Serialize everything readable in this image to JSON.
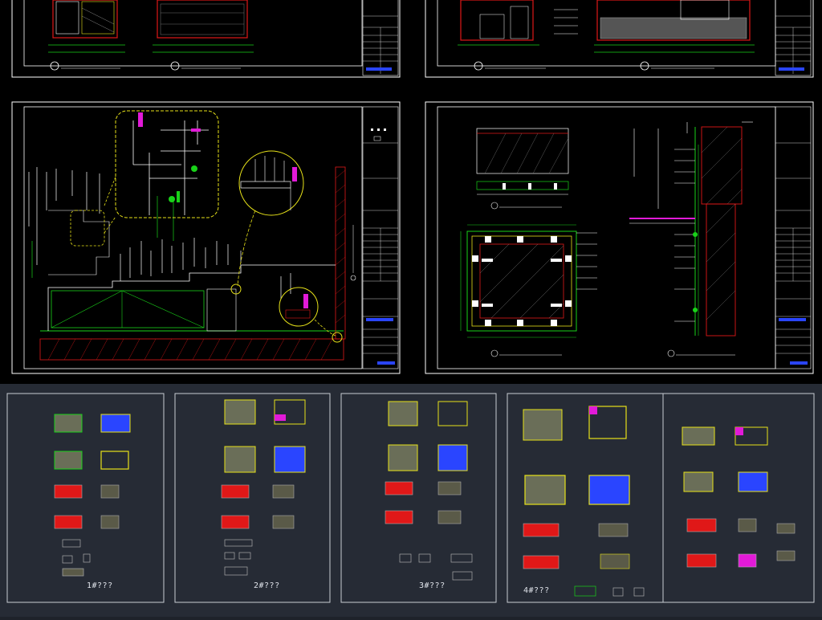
{
  "colors": {
    "top_background": "#000000",
    "bottom_background": "#262b35",
    "frame": "#ffffff",
    "accent_green": "#19d219",
    "accent_yellow": "#e7e219",
    "accent_red": "#e01818",
    "accent_magenta": "#e21ad8",
    "accent_blue": "#2a45ff",
    "accent_cyan": "#25c6d6"
  },
  "sheets": {
    "sheet_1_label": "1#???",
    "sheet_2_label": "2#???",
    "sheet_3_label": "3#???",
    "sheet_4_label": "4#???"
  },
  "icons": {
    "detail_callout": "circle-detail-icon",
    "section_marker": "section-marker-icon"
  }
}
